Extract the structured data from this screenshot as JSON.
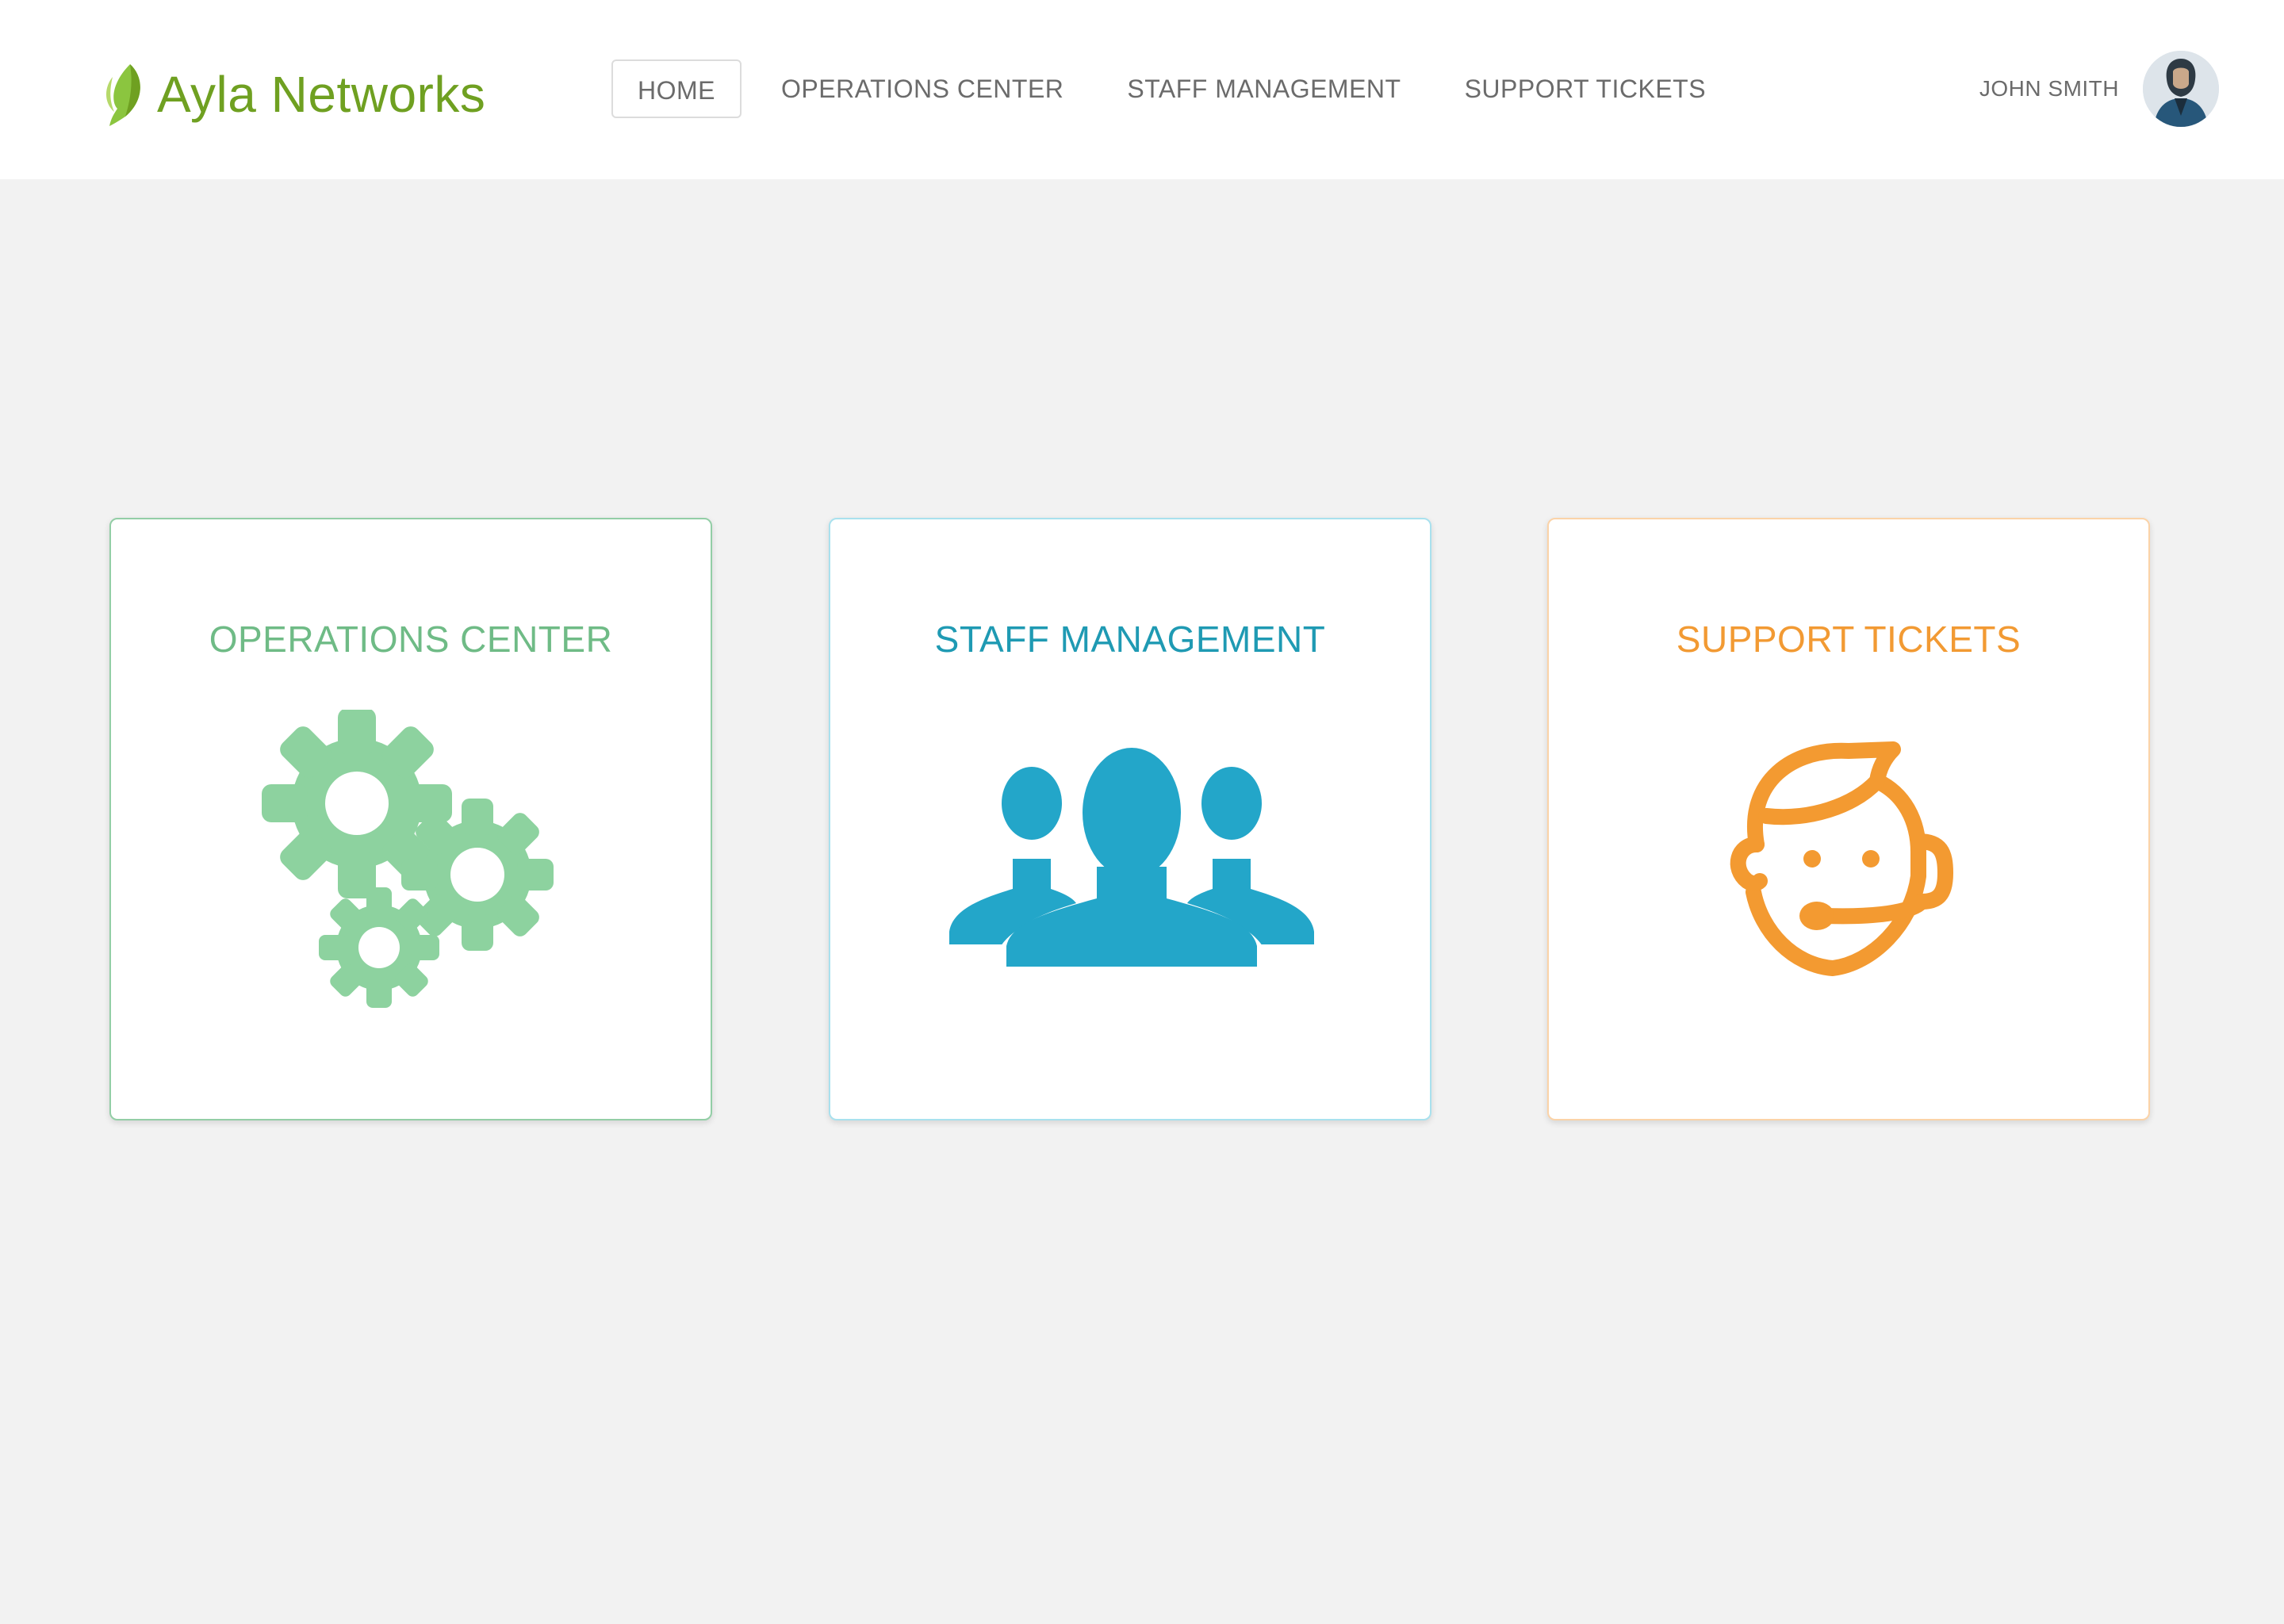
{
  "app": {
    "brand": "Ayla Networks"
  },
  "nav": {
    "items": [
      {
        "label": "HOME",
        "active": true
      },
      {
        "label": "OPERATIONS CENTER",
        "active": false
      },
      {
        "label": "STAFF MANAGEMENT",
        "active": false
      },
      {
        "label": "SUPPORT TICKETS",
        "active": false
      }
    ]
  },
  "user": {
    "name": "JOHN SMITH",
    "avatar_icon": "user-avatar"
  },
  "cards": [
    {
      "title": "OPERATIONS CENTER",
      "icon": "gears-icon",
      "color": "#8dd29f"
    },
    {
      "title": "STAFF MANAGEMENT",
      "icon": "people-icon",
      "color": "#23a6c9"
    },
    {
      "title": "SUPPORT TICKETS",
      "icon": "support-agent-icon",
      "color": "#f39a31"
    }
  ],
  "colors": {
    "brand_green": "#6fa021",
    "background": "#f2f2f2"
  }
}
